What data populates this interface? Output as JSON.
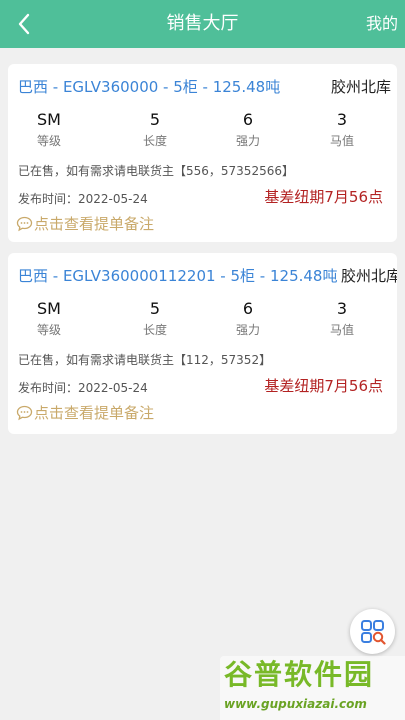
{
  "header": {
    "title": "销售大厅",
    "right_label": "我的"
  },
  "listings": [
    {
      "product": "巴西 - EGLV360000 - 5柜 - 125.48吨",
      "warehouse": "胶州北库",
      "specs": [
        {
          "value": "SM",
          "label": "等级"
        },
        {
          "value": "5",
          "label": "长度"
        },
        {
          "value": "6",
          "label": "强力"
        },
        {
          "value": "3",
          "label": "马值"
        }
      ],
      "status": "已在售，如有需求请电联货主【556，57352566】",
      "publish_date": "发布时间：2022-05-24",
      "basis": "基差纽期7月56点",
      "note_link": "点击查看提单备注"
    },
    {
      "product": "巴西 - EGLV360000112201 - 5柜 - 125.48吨",
      "warehouse": "胶州北库",
      "specs": [
        {
          "value": "SM",
          "label": "等级"
        },
        {
          "value": "5",
          "label": "长度"
        },
        {
          "value": "6",
          "label": "强力"
        },
        {
          "value": "3",
          "label": "马值"
        }
      ],
      "status": "已在售，如有需求请电联货主【112，57352】",
      "publish_date": "发布时间：2022-05-24",
      "basis": "基差纽期7月56点",
      "note_link": "点击查看提单备注"
    }
  ],
  "watermark": {
    "logo": "谷普软件园",
    "url": "www.gupuxiazai.com"
  },
  "colors": {
    "header_bg": "#4fbf99",
    "product_link": "#3b84d6",
    "basis_red": "#b32323",
    "note_gold": "#c9a96a"
  }
}
